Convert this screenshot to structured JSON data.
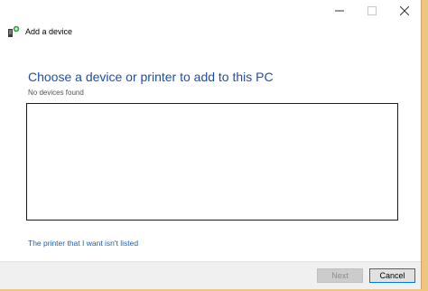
{
  "window": {
    "title": "Add a device"
  },
  "title_controls": {
    "minimize_icon": "minimize-icon",
    "maximize_icon": "maximize-icon",
    "close_icon": "close-icon"
  },
  "main": {
    "heading": "Choose a device or printer to add to this PC",
    "status": "No devices found",
    "printer_link": "The printer that I want isn't listed"
  },
  "footer": {
    "next_label": "Next",
    "cancel_label": "Cancel"
  },
  "colors": {
    "accent": "#1f4e9b",
    "link": "#1a5fb4",
    "desktop_background": "#f0c67c",
    "focus_border": "#0078d7"
  }
}
